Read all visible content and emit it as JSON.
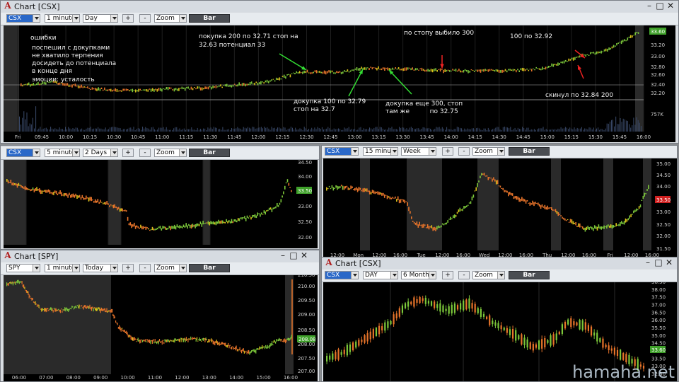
{
  "windows": [
    {
      "id": "w1",
      "title": "Chart [CSX]",
      "symbol": "CSX",
      "interval": "1 minute",
      "period": "Day",
      "zoom": "Zoom",
      "bar": "Bar",
      "plus": "+",
      "minus": "-",
      "price_badge": "33.60",
      "volume_label": "757K",
      "y_ticks": [
        "33.60",
        "33.20",
        "33.00",
        "32.80",
        "32.60",
        "32.40",
        "32.20"
      ],
      "x_ticks": [
        "Fri",
        "09:45",
        "10:00",
        "10:15",
        "10:30",
        "10:45",
        "11:00",
        "11:15",
        "11:30",
        "11:45",
        "12:00",
        "12:15",
        "12:30",
        "12:45",
        "13:00",
        "13:15",
        "13:30",
        "13:45",
        "14:00",
        "14:15",
        "14:30",
        "14:45",
        "15:00",
        "15:15",
        "15:30",
        "15:45",
        "16:00"
      ],
      "annotations": {
        "errors_title": "ошибки",
        "error1": "поспешил с докупками",
        "error2": "не хватило терпения",
        "error3": "досидеть до потенциала",
        "error4": "в конце дня",
        "error5": "эмоции: усталость",
        "buy1_line1": "покупка 200 по 32.71 стоп на",
        "buy1_line2": "32.63 потенциал 33",
        "stop_out": "по стопу выбило 300",
        "add100": "100 по 32.92",
        "add1_line1": "докупка 100 по 32.79",
        "add1_line2": "стоп на 32.7",
        "add2_line1": "докупка еще 300, стоп",
        "add2_line2": "там же          по 32.75",
        "sold": "скинул по 32.84 200"
      },
      "arrow_colors": {
        "green": "#33dd33",
        "red": "#ee2222"
      }
    },
    {
      "id": "w2",
      "symbol": "CSX",
      "interval": "5 minutes",
      "period": "2 Days",
      "zoom": "Zoom",
      "bar": "Bar",
      "plus": "+",
      "minus": "-",
      "price_badge": "33.50",
      "y_ticks": [
        "34.50",
        "34.00",
        "33.50",
        "33.00",
        "32.50",
        "32.00"
      ]
    },
    {
      "id": "w3",
      "symbol": "CSX",
      "interval": "15 minutes",
      "period": "Week",
      "zoom": "Zoom",
      "bar": "Bar",
      "plus": "+",
      "minus": "-",
      "price_badge": "33.50",
      "y_ticks": [
        "35.00",
        "34.50",
        "34.00",
        "33.50",
        "33.00",
        "32.50",
        "32.00",
        "31.50"
      ],
      "x_ticks": [
        "12:00",
        "Mon",
        "12:00",
        "16:00",
        "Tue",
        "12:00",
        "16:00",
        "Wed",
        "12:00",
        "16:00",
        "Thu",
        "12:00",
        "16:00",
        "Fri",
        "12:00",
        "16:00"
      ]
    },
    {
      "id": "w4",
      "title": "Chart [SPY]",
      "symbol": "SPY",
      "interval": "1 minute",
      "period": "Today",
      "zoom": "Zoom",
      "bar": "Bar",
      "plus": "+",
      "minus": "-",
      "price_badge": "208.08",
      "y_ticks": [
        "210.50",
        "210.00",
        "209.50",
        "209.00",
        "208.50",
        "208.00",
        "207.50",
        "207.00"
      ],
      "x_ticks": [
        "06:00",
        "07:00",
        "08:00",
        "09:00",
        "10:00",
        "11:00",
        "12:00",
        "13:00",
        "14:00",
        "15:00",
        "16:00"
      ]
    },
    {
      "id": "w5",
      "title": "Chart [CSX]",
      "symbol": "CSX",
      "interval": "DAY",
      "period": "6 Months",
      "zoom": "Zoom",
      "bar": "Bar",
      "plus": "+",
      "minus": "-",
      "price_badge": "33.60",
      "y_ticks": [
        "38.50",
        "38.00",
        "37.50",
        "37.00",
        "36.50",
        "36.00",
        "35.50",
        "35.00",
        "34.50",
        "34.00",
        "33.50",
        "33.00",
        "32.50"
      ]
    }
  ],
  "watermark": "hamaha.net",
  "colors": {
    "up": "#7cc83a",
    "down": "#e8742a",
    "neutral": "#d9c21a",
    "badge_green": "#3fa02a",
    "badge_red": "#d02020"
  }
}
